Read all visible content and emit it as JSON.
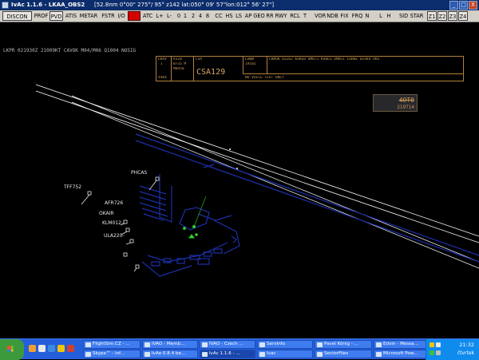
{
  "window": {
    "title": "IvAc 1.1.6 - LKAA_OBS2",
    "info": "[52.8nm   0°00\"   275°/ 95°   z142   lat:050° 09' 57\"lon:012° 56' 27\"]",
    "controls": [
      "_",
      "□",
      "X"
    ]
  },
  "toolbar": {
    "items": [
      "DISCON",
      "PROF",
      "PVD",
      "ATIS",
      "METAR",
      "FSTR",
      "I/O",
      "",
      "ATC",
      "L+",
      "L-",
      "0",
      "1",
      "2",
      "4",
      "8",
      "CC",
      "HS",
      "LS",
      "AP",
      "GEO",
      "RR",
      "RWY",
      "RCL",
      "T",
      "VOR",
      "NDB",
      "FIX",
      "FRQ",
      "N",
      "L",
      "H",
      "SID",
      "STAR",
      "Z1",
      "Z2",
      "Z3",
      "Z4"
    ]
  },
  "metar": "LKPR 021930Z 21009KT CAVOK M04/M06 Q1004 NOSIG",
  "strip": {
    "col1": [
      "LKAV",
      "I",
      "4404"
    ],
    "col2": [
      "A320",
      "0735 M",
      "M0450"
    ],
    "col3": [
      "CSA"
    ],
    "callsign": "CSA129",
    "col4": [
      "LOWW",
      "1918Z"
    ],
    "route": "LKMUK DZ262 KURED OM871 KUDES OM851 LORKE UL984 OKG",
    "remarks": "NO VOICE TEXT ONLY"
  },
  "tag": {
    "line1": "4OT0",
    "line2": "219714"
  },
  "aircraft": [
    {
      "label": "PHCAS"
    },
    {
      "label": "TFF752"
    },
    {
      "label": "AFR726"
    },
    {
      "label": "OKAIR"
    },
    {
      "label": "KLM012-"
    },
    {
      "label": "ULA220-"
    }
  ],
  "taskbar": {
    "tasks": [
      {
        "label": "FlightSim.CZ - ..."
      },
      {
        "label": "IVAO - Memb..."
      },
      {
        "label": "IVAO - Czech ..."
      },
      {
        "label": "ServInfo"
      },
      {
        "label": "Pavel König - ..."
      },
      {
        "label": "Edvin - Messa..."
      },
      {
        "label": "Skype™ - inf..."
      },
      {
        "label": "IvAe 0.8.4 be..."
      },
      {
        "label": "IvAc 1.1.6 - ..."
      },
      {
        "label": "Ivac"
      },
      {
        "label": "SectorFiles"
      },
      {
        "label": "Microsoft Pow..."
      }
    ],
    "clock": "21:32",
    "day": "čtvrtek"
  },
  "colors": {
    "radar_bg": "#000000",
    "runway_lines": "#ffffff",
    "taxiway_blue": "#1c2fa8",
    "green_items": "#2fd02f",
    "strip_amber": "#c99a5a",
    "alert_red": "#d40000"
  }
}
